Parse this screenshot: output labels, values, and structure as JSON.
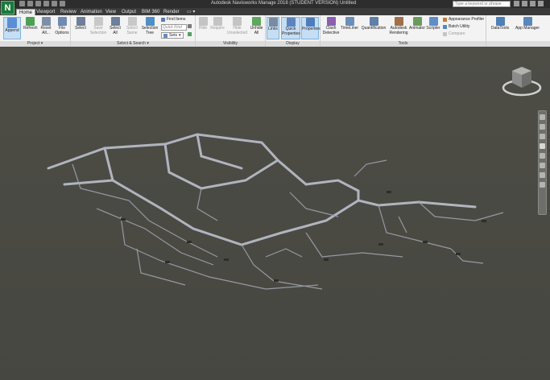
{
  "app": {
    "logo_letter": "N",
    "title": "Autodesk Navisworks Manage 2018 (STUDENT VERSION)    Untitled",
    "search_placeholder": "Type a keyword or phrase"
  },
  "tabs": [
    "Home",
    "Viewport",
    "Review",
    "Animation",
    "View",
    "Output",
    "BIM 360",
    "Render"
  ],
  "active_tab": "Home",
  "panels": {
    "project": {
      "title": "Project ▾",
      "buttons": [
        "Append",
        "Refresh",
        "Reset All...",
        "File Options"
      ]
    },
    "select_search": {
      "title": "Select & Search ▾",
      "buttons": [
        "Select",
        "Save Selection",
        "Select All",
        "Select Same",
        "Selection Tree"
      ],
      "find_items": "Find Items",
      "quick_find_placeholder": "Quick Find",
      "sets_label": "Sets"
    },
    "visibility": {
      "title": "Visibility",
      "buttons": [
        "Hide",
        "Require",
        "Hide Unselected",
        "Unhide All"
      ]
    },
    "display": {
      "title": "Display",
      "buttons": [
        "Links",
        "Quick Properties",
        "Properties"
      ]
    },
    "tools": {
      "title": "Tools",
      "buttons": [
        "Clash Detective",
        "TimeLiner",
        "Quantification",
        "Autodesk Rendering",
        "Animator",
        "Scripter"
      ],
      "small": [
        "Appearance Profiler",
        "Batch Utility",
        "Compare"
      ]
    },
    "extra": {
      "buttons": [
        "DataTools",
        "App Manager"
      ]
    }
  },
  "colors": {
    "viewport_bg": "#4a4a44",
    "ribbon_bg": "#f3f3f3",
    "highlight": "#c6def3",
    "pipe": "#b8bcc8"
  }
}
